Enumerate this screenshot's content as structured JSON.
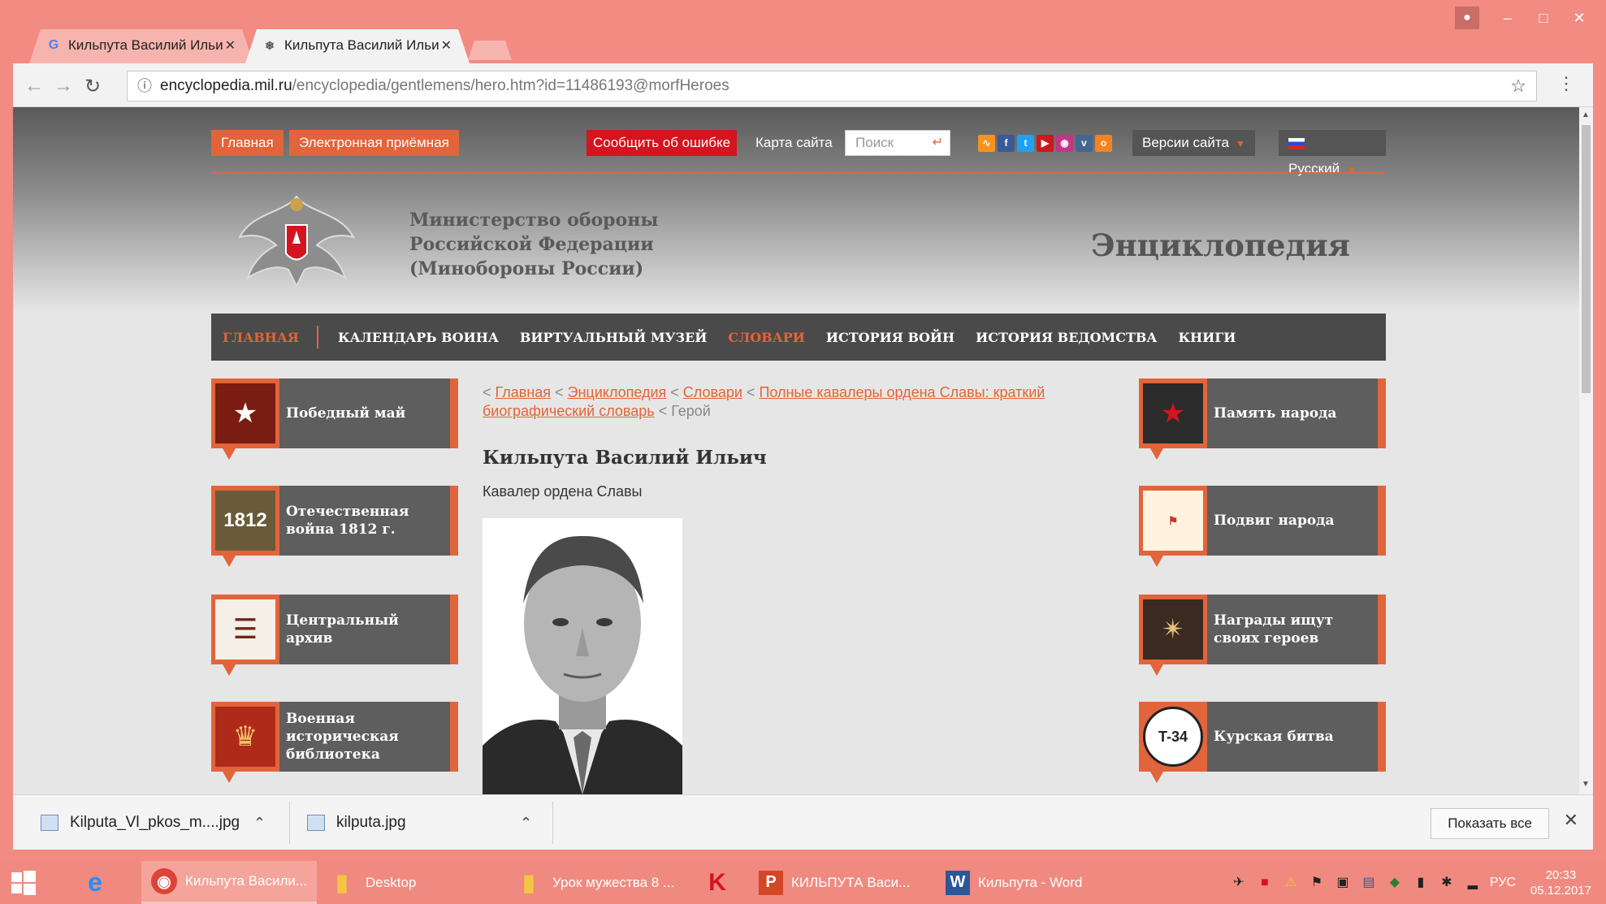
{
  "browser": {
    "tabs": [
      {
        "title": "Кильпута Василий Ильи",
        "favicon": "google-g-icon",
        "active": false
      },
      {
        "title": "Кильпута Василий Ильи",
        "favicon": "ministry-emblem-icon",
        "active": true
      }
    ],
    "url_host": "encyclopedia.mil.ru",
    "url_path": "/encyclopedia/gentlemens/hero.htm?id=11486193@morfHeroes"
  },
  "site": {
    "top_links": [
      "Главная",
      "Электронная приёмная"
    ],
    "report_error": "Сообщить об ошибке",
    "sitemap": "Карта сайта",
    "search_placeholder": "Поиск",
    "versions": "Версии сайта",
    "language": "Русский",
    "ministry_lines": [
      "Министерство обороны",
      "Российской Федерации",
      "(Минобороны России)"
    ],
    "section_title": "Энциклопедия",
    "nav": [
      {
        "label": "ГЛАВНАЯ",
        "accent": true
      },
      {
        "label": "КАЛЕНДАРЬ ВОИНА",
        "accent": false
      },
      {
        "label": "ВИРТУАЛЬНЫЙ МУЗЕЙ",
        "accent": false
      },
      {
        "label": "СЛОВАРИ",
        "accent": true
      },
      {
        "label": "ИСТОРИЯ ВОЙН",
        "accent": false
      },
      {
        "label": "ИСТОРИЯ ВЕДОМСТВА",
        "accent": false
      },
      {
        "label": "КНИГИ",
        "accent": false
      }
    ],
    "left_tiles": [
      "Победный май",
      "Отечественная война 1812 г.",
      "Центральный архив",
      "Военная историческая библиотека"
    ],
    "right_tiles": [
      "Память народа",
      "Подвиг народа",
      "Награды ищут своих героев",
      "Курская битва"
    ],
    "breadcrumbs": {
      "home": "Главная",
      "encyclopedia": "Энциклопедия",
      "dictionaries": "Словари",
      "dictionary": "Полные кавалеры ордена Славы: краткий биографический словарь",
      "current": "Герой"
    },
    "hero_name": "Кильпута Василий Ильич",
    "hero_subtitle": "Кавалер ордена Славы"
  },
  "downloads": {
    "items": [
      "Kilputa_Vl_pkos_m....jpg",
      "kilputa.jpg"
    ],
    "show_all": "Показать все"
  },
  "taskbar": {
    "items": [
      "Кильпута Васили...",
      "Desktop",
      "Урок мужества 8 ...",
      "КИЛЬПУТА Васи...",
      "Кильпута - Word"
    ],
    "lang": "РУС",
    "time": "20:33",
    "date": "05.12.2017"
  },
  "colors": {
    "accent": "#e2643a",
    "nav_bg": "#4a4a4a",
    "error_red": "#d4141e",
    "window_frame": "#f28b82"
  }
}
